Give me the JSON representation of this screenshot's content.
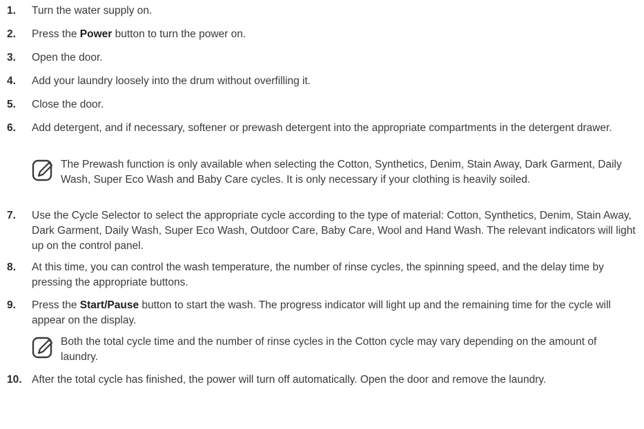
{
  "steps": [
    {
      "num": "1.",
      "text": "Turn the water supply on."
    },
    {
      "num": "2.",
      "pre": "Press the ",
      "bold": "Power",
      "post": " button to turn the power on."
    },
    {
      "num": "3.",
      "text": "Open the door."
    },
    {
      "num": "4.",
      "text": "Add your laundry loosely into the drum without overfilling it."
    },
    {
      "num": "5.",
      "text": "Close the door."
    },
    {
      "num": "6.",
      "text": "Add detergent, and if necessary, softener or prewash detergent into the appropriate compartments in the detergent drawer."
    },
    {
      "num": "7.",
      "text": "Use the Cycle Selector to select the appropriate cycle according to the type of material: Cotton, Synthetics, Denim, Stain Away, Dark Garment, Daily Wash, Super Eco Wash, Outdoor Care, Baby Care, Wool and Hand Wash. The relevant indicators will light up on the control panel."
    },
    {
      "num": "8.",
      "text": "At this time, you can control the wash temperature, the number of rinse cycles, the spinning speed, and the delay time by pressing the appropriate buttons."
    },
    {
      "num": "9.",
      "pre": "Press the ",
      "bold": "Start/Pause",
      "post": " button to start the wash. The progress indicator will light up and the remaining time for the cycle will appear on the display."
    },
    {
      "num": "10.",
      "text": "After the total cycle has finished, the power will turn off automatically. Open the door and remove the laundry."
    }
  ],
  "notes": [
    {
      "icon": "note-pencil-icon",
      "text": "The Prewash function is only available when selecting the Cotton, Synthetics, Denim, Stain Away, Dark Garment, Daily Wash, Super Eco Wash and Baby Care cycles. It is only necessary if your clothing is heavily soiled."
    },
    {
      "icon": "note-pencil-icon",
      "text": "Both the total cycle time and the number of rinse cycles in the Cotton cycle may vary depending on the amount of laundry."
    }
  ]
}
